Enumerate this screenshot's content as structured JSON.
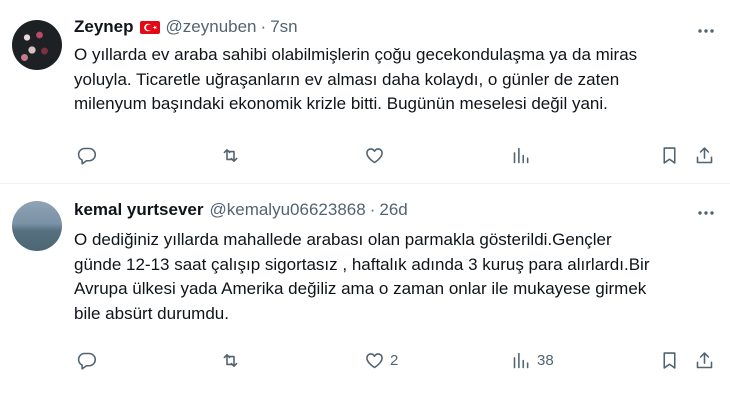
{
  "tweets": [
    {
      "name": "Zeynep",
      "handle": "@zeynuben",
      "separator": "·",
      "time": "7sn",
      "flag": "turkey-flag",
      "lines": [
        "O yıllarda ev araba sahibi olabilmişlerin çoğu gecekondulaşma ya da miras",
        "yoluyla. Ticaretle uğraşanların ev alması daha kolaydı, o günler de zaten",
        "milenyum başındaki ekonomik krizle bitti. Bugünün meselesi değil yani."
      ],
      "actions": {
        "reply": "",
        "retweet": "",
        "like": "",
        "views": ""
      }
    },
    {
      "name": "kemal yurtsever",
      "handle": "@kemalyu06623868",
      "separator": "·",
      "time": "26d",
      "lines": [
        "O dediğiniz yıllarda mahallede arabası olan parmakla gösterildi.Gençler",
        "günde 12-13 saat çalışıp sigortasız , haftalık adında 3 kuruş para alırlardı.Bir",
        "Avrupa ülkesi yada Amerika değiliz ama o zaman onlar ile mukayese girmek",
        "bile absürt durumdu."
      ],
      "actions": {
        "reply": "",
        "retweet": "",
        "like": "2",
        "views": "38"
      }
    }
  ],
  "colors": {
    "text": "#0f1419",
    "secondary": "#536471",
    "divider": "#eff3f4",
    "flag": "#e30a17"
  },
  "icons": [
    "more-icon",
    "reply-icon",
    "retweet-icon",
    "like-icon",
    "views-icon",
    "bookmark-icon",
    "share-icon"
  ]
}
